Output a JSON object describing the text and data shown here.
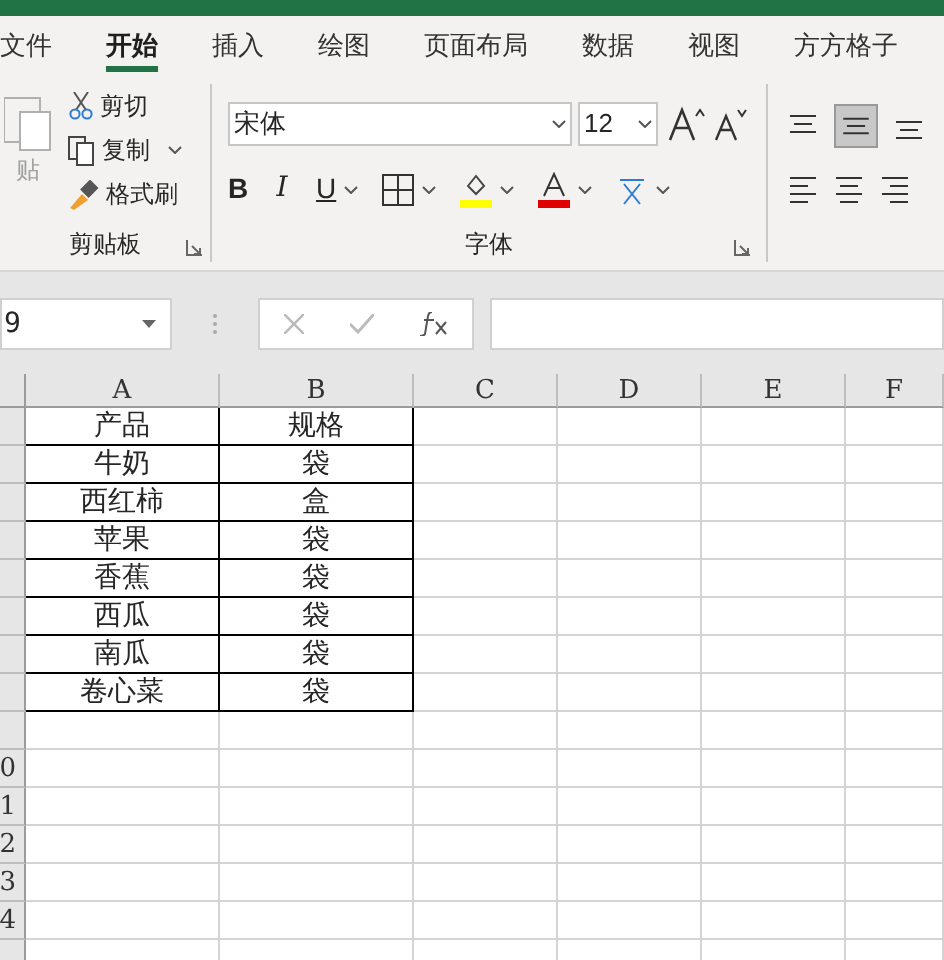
{
  "tabs": [
    {
      "label": "文件",
      "selected": false
    },
    {
      "label": "开始",
      "selected": true
    },
    {
      "label": "插入",
      "selected": false
    },
    {
      "label": "绘图",
      "selected": false
    },
    {
      "label": "页面布局",
      "selected": false
    },
    {
      "label": "数据",
      "selected": false
    },
    {
      "label": "视图",
      "selected": false
    },
    {
      "label": "方方格子",
      "selected": false
    }
  ],
  "clipboard": {
    "paste": "贴",
    "cut": "剪切",
    "copy": "复制",
    "format_painter": "格式刷",
    "label": "剪贴板"
  },
  "font": {
    "name": "宋体",
    "size": "12",
    "bold": "B",
    "italic": "I",
    "underline": "U",
    "label": "字体"
  },
  "formula_bar": {
    "name_box": "9"
  },
  "sheet": {
    "columns": [
      "A",
      "B",
      "C",
      "D",
      "E",
      "F"
    ],
    "rows": [
      {
        "cells": [
          "产品",
          "规格"
        ]
      },
      {
        "cells": [
          "牛奶",
          "袋"
        ]
      },
      {
        "cells": [
          "西红柿",
          "盒"
        ]
      },
      {
        "cells": [
          "苹果",
          "袋"
        ]
      },
      {
        "cells": [
          "香蕉",
          "袋"
        ]
      },
      {
        "cells": [
          "西瓜",
          "袋"
        ]
      },
      {
        "cells": [
          "南瓜",
          "袋"
        ]
      },
      {
        "cells": [
          "卷心菜",
          "袋"
        ]
      },
      {
        "cells": []
      },
      {
        "header": "0",
        "cells": []
      },
      {
        "header": "1",
        "cells": []
      },
      {
        "header": "2",
        "cells": []
      },
      {
        "header": "3",
        "cells": []
      },
      {
        "header": "4",
        "cells": []
      },
      {
        "cells": []
      }
    ]
  }
}
